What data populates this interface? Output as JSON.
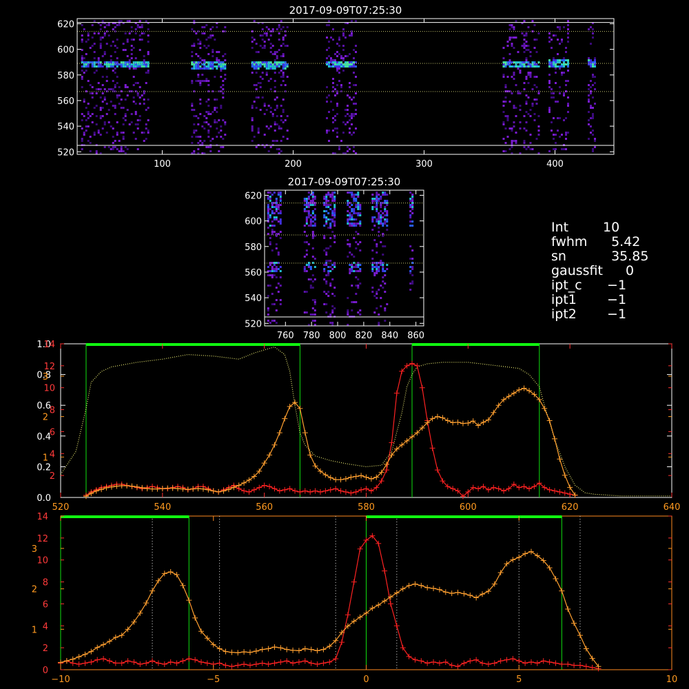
{
  "chart_data": [
    {
      "type": "heatmap",
      "id": "top-spectrogram",
      "title": "2017-09-09T07:25:30",
      "xlim": [
        35,
        445
      ],
      "ylim": [
        518,
        624
      ],
      "xticks": [
        100,
        200,
        300,
        400
      ],
      "yticks": [
        520,
        540,
        560,
        580,
        600,
        620
      ],
      "hlines_dotted": [
        614,
        589,
        567
      ],
      "hlines_solid": [
        621,
        525
      ],
      "bright_columns": [
        {
          "x": [
            38,
            90
          ],
          "core": 589
        },
        {
          "x": [
            122,
            148
          ],
          "core": 588
        },
        {
          "x": [
            168,
            196
          ],
          "core": 588
        },
        {
          "x": [
            225,
            248
          ],
          "core": 589
        },
        {
          "x": [
            360,
            388
          ],
          "core": 589
        },
        {
          "x": [
            395,
            410
          ],
          "core": 590
        },
        {
          "x": [
            425,
            430
          ],
          "core": 590
        }
      ]
    },
    {
      "type": "heatmap",
      "id": "zoom-spectrogram",
      "title": "2017-09-09T07:25:30",
      "xlim": [
        744,
        866
      ],
      "ylim": [
        518,
        624
      ],
      "xticks": [
        760,
        780,
        800,
        820,
        840,
        860
      ],
      "yticks": [
        520,
        540,
        560,
        580,
        600,
        620
      ],
      "hlines_dotted": [
        614,
        589,
        567
      ],
      "hlines_solid": [
        525
      ],
      "bright_columns": [
        {
          "x": [
            746,
            756
          ]
        },
        {
          "x": [
            774,
            782
          ]
        },
        {
          "x": [
            789,
            797
          ]
        },
        {
          "x": [
            807,
            817
          ]
        },
        {
          "x": [
            826,
            838
          ]
        },
        {
          "x": [
            855,
            858
          ]
        }
      ]
    },
    {
      "type": "line",
      "id": "profile-chart",
      "xlim": [
        520,
        640
      ],
      "xticks": [
        520,
        540,
        560,
        580,
        600,
        620,
        640
      ],
      "ylim_left_white": [
        0,
        1.0
      ],
      "yticks_left_white": [
        "0.0",
        "0.2",
        "0.4",
        "0.6",
        "0.8",
        "1.0"
      ],
      "ylim_left_red": [
        0,
        14
      ],
      "yticks_left_red": [
        "2",
        "4",
        "6",
        "8",
        "10",
        "12",
        "14"
      ],
      "yticks_left_orange": [
        "1",
        "2",
        "3"
      ],
      "orange_scale_max": 3.8,
      "green_bands": [
        [
          525,
          567
        ],
        [
          589,
          614
        ]
      ],
      "series": [
        {
          "color": "#e8e870",
          "style": "dotted",
          "axis": "white",
          "x": [
            520,
            523,
            525,
            526,
            528,
            530,
            535,
            540,
            545,
            550,
            555,
            558,
            560,
            562,
            564,
            565,
            566,
            567,
            568,
            570,
            573,
            576,
            580,
            583,
            585,
            587,
            588,
            589,
            590,
            592,
            595,
            600,
            605,
            610,
            612,
            614,
            615,
            617,
            619,
            621,
            623,
            625,
            630,
            635,
            640
          ],
          "y": [
            0.15,
            0.3,
            0.58,
            0.75,
            0.82,
            0.85,
            0.88,
            0.9,
            0.93,
            0.92,
            0.9,
            0.94,
            0.96,
            0.98,
            0.93,
            0.82,
            0.6,
            0.42,
            0.34,
            0.27,
            0.24,
            0.22,
            0.2,
            0.21,
            0.3,
            0.55,
            0.72,
            0.8,
            0.85,
            0.87,
            0.88,
            0.88,
            0.86,
            0.84,
            0.8,
            0.72,
            0.6,
            0.38,
            0.2,
            0.08,
            0.03,
            0.02,
            0.01,
            0.01,
            0.01
          ]
        },
        {
          "color": "#ff2222",
          "style": "line-plus",
          "axis": "red",
          "x": [
            525,
            526,
            527,
            528,
            529,
            530,
            531,
            532,
            533,
            534,
            535,
            536,
            537,
            538,
            539,
            540,
            541,
            542,
            543,
            544,
            545,
            546,
            547,
            548,
            549,
            550,
            551,
            552,
            553,
            554,
            555,
            556,
            557,
            558,
            559,
            560,
            561,
            562,
            563,
            564,
            565,
            566,
            567,
            568,
            569,
            570,
            571,
            572,
            573,
            574,
            575,
            576,
            577,
            578,
            579,
            580,
            581,
            582,
            583,
            584,
            585,
            586,
            587,
            588,
            589,
            590,
            591,
            592,
            593,
            594,
            595,
            596,
            597,
            598,
            599,
            600,
            601,
            602,
            603,
            604,
            605,
            606,
            607,
            608,
            609,
            610,
            611,
            612,
            613,
            614,
            615,
            616,
            617,
            618,
            619,
            620,
            621
          ],
          "y": [
            0.2,
            0.5,
            0.7,
            0.9,
            1.0,
            1.1,
            1.2,
            1.2,
            1.1,
            1.0,
            0.9,
            0.8,
            0.9,
            1.0,
            0.9,
            0.8,
            0.8,
            0.9,
            1.0,
            0.9,
            0.7,
            0.8,
            1.0,
            1.0,
            0.8,
            0.6,
            0.5,
            0.7,
            0.9,
            1.1,
            0.8,
            0.6,
            0.5,
            0.7,
            0.9,
            1.1,
            1.0,
            0.8,
            0.6,
            0.7,
            0.8,
            0.6,
            0.5,
            0.6,
            0.5,
            0.6,
            0.5,
            0.6,
            0.7,
            0.8,
            0.6,
            0.5,
            0.4,
            0.5,
            0.7,
            0.8,
            0.6,
            0.9,
            1.5,
            2.5,
            5.0,
            9.5,
            11.5,
            12.0,
            12.2,
            12.0,
            10.0,
            7.0,
            4.5,
            2.5,
            1.5,
            1.0,
            0.8,
            0.6,
            0.1,
            0.5,
            0.9,
            0.8,
            1.0,
            0.7,
            0.9,
            0.8,
            0.6,
            0.8,
            1.2,
            0.9,
            1.0,
            0.8,
            1.0,
            1.3,
            0.9,
            0.7,
            0.6,
            0.5,
            0.4,
            0.3,
            0.2
          ]
        },
        {
          "color": "#ffa030",
          "style": "line-plus",
          "axis": "orange",
          "x": [
            525,
            526,
            527,
            528,
            529,
            530,
            531,
            532,
            533,
            534,
            535,
            536,
            537,
            538,
            539,
            540,
            541,
            542,
            543,
            544,
            545,
            546,
            547,
            548,
            549,
            550,
            551,
            552,
            553,
            554,
            555,
            556,
            557,
            558,
            559,
            560,
            561,
            562,
            563,
            564,
            565,
            566,
            567,
            568,
            569,
            570,
            571,
            572,
            573,
            574,
            575,
            576,
            577,
            578,
            579,
            580,
            581,
            582,
            583,
            584,
            585,
            586,
            587,
            588,
            589,
            590,
            591,
            592,
            593,
            594,
            595,
            596,
            597,
            598,
            599,
            600,
            601,
            602,
            603,
            604,
            605,
            606,
            607,
            608,
            609,
            610,
            611,
            612,
            613,
            614,
            615,
            616,
            617,
            618,
            619,
            620,
            621
          ],
          "y": [
            0.03,
            0.1,
            0.16,
            0.2,
            0.24,
            0.26,
            0.28,
            0.29,
            0.29,
            0.28,
            0.26,
            0.24,
            0.22,
            0.21,
            0.21,
            0.22,
            0.23,
            0.23,
            0.22,
            0.21,
            0.2,
            0.21,
            0.22,
            0.21,
            0.19,
            0.16,
            0.14,
            0.16,
            0.2,
            0.25,
            0.3,
            0.36,
            0.43,
            0.52,
            0.65,
            0.85,
            1.05,
            1.3,
            1.6,
            1.95,
            2.25,
            2.35,
            2.2,
            1.6,
            1.05,
            0.78,
            0.65,
            0.56,
            0.49,
            0.44,
            0.44,
            0.46,
            0.5,
            0.52,
            0.54,
            0.5,
            0.46,
            0.5,
            0.62,
            0.82,
            1.05,
            1.2,
            1.3,
            1.4,
            1.5,
            1.6,
            1.72,
            1.85,
            1.95,
            2.0,
            1.97,
            1.9,
            1.85,
            1.86,
            1.83,
            1.84,
            1.89,
            1.78,
            1.86,
            1.92,
            2.1,
            2.28,
            2.42,
            2.5,
            2.58,
            2.66,
            2.7,
            2.64,
            2.55,
            2.42,
            2.2,
            1.9,
            1.45,
            0.95,
            0.55,
            0.25,
            0.06
          ]
        }
      ]
    },
    {
      "type": "line",
      "id": "velocity-chart",
      "xlim": [
        -10,
        10
      ],
      "xticks": [
        -10,
        -5,
        0,
        5,
        10
      ],
      "ylim_left_red": [
        0,
        14
      ],
      "yticks_left_red": [
        "0",
        "2",
        "4",
        "6",
        "8",
        "10",
        "12",
        "14"
      ],
      "yticks_left_orange": [
        "1",
        "2",
        "3"
      ],
      "orange_scale_max": 3.8,
      "green_bands": [
        [
          -10,
          -5.8
        ],
        [
          0,
          6.4
        ]
      ],
      "vlines_dotted": [
        -7,
        -4.8,
        -1,
        1,
        5,
        7
      ],
      "series": [
        {
          "color": "#ff2222",
          "style": "line-plus",
          "axis": "red",
          "x": [
            -10,
            -9.8,
            -9.6,
            -9.4,
            -9.2,
            -9,
            -8.8,
            -8.6,
            -8.4,
            -8.2,
            -8,
            -7.8,
            -7.6,
            -7.4,
            -7.2,
            -7,
            -6.8,
            -6.6,
            -6.4,
            -6.2,
            -6,
            -5.8,
            -5.6,
            -5.4,
            -5.2,
            -5,
            -4.8,
            -4.6,
            -4.4,
            -4.2,
            -4,
            -3.8,
            -3.6,
            -3.4,
            -3.2,
            -3,
            -2.8,
            -2.6,
            -2.4,
            -2.2,
            -2,
            -1.8,
            -1.6,
            -1.4,
            -1.2,
            -1,
            -0.8,
            -0.6,
            -0.4,
            -0.2,
            0,
            0.2,
            0.4,
            0.6,
            0.8,
            1,
            1.2,
            1.4,
            1.6,
            1.8,
            2,
            2.2,
            2.4,
            2.6,
            2.8,
            3,
            3.2,
            3.4,
            3.6,
            3.8,
            4,
            4.2,
            4.4,
            4.6,
            4.8,
            5,
            5.2,
            5.4,
            5.6,
            5.8,
            6,
            6.2,
            6.4,
            6.6,
            6.8,
            7,
            7.2,
            7.4,
            7.6
          ],
          "y": [
            0.6,
            0.8,
            0.6,
            0.5,
            0.6,
            0.7,
            0.9,
            1.0,
            0.8,
            0.6,
            0.6,
            0.8,
            0.7,
            0.5,
            0.6,
            0.8,
            0.6,
            0.5,
            0.7,
            0.6,
            0.8,
            1.0,
            0.9,
            0.7,
            0.6,
            0.5,
            0.6,
            0.4,
            0.3,
            0.4,
            0.5,
            0.4,
            0.5,
            0.6,
            0.5,
            0.6,
            0.7,
            0.8,
            0.6,
            0.7,
            0.8,
            0.6,
            0.5,
            0.6,
            0.7,
            1.0,
            2.5,
            5.0,
            8.0,
            11.0,
            11.8,
            12.2,
            11.5,
            9.0,
            6.0,
            4.0,
            2.0,
            1.2,
            0.9,
            0.8,
            0.6,
            0.7,
            0.6,
            0.7,
            0.4,
            0.3,
            0.6,
            0.8,
            0.9,
            0.6,
            0.5,
            0.6,
            0.8,
            0.9,
            1.0,
            0.8,
            0.6,
            0.7,
            0.6,
            0.8,
            0.7,
            0.6,
            0.5,
            0.5,
            0.4,
            0.4,
            0.3,
            0.2,
            0.1
          ]
        },
        {
          "color": "#ffa030",
          "style": "line-plus",
          "axis": "orange",
          "x": [
            -10,
            -9.8,
            -9.6,
            -9.4,
            -9.2,
            -9,
            -8.8,
            -8.6,
            -8.4,
            -8.2,
            -8,
            -7.8,
            -7.6,
            -7.4,
            -7.2,
            -7,
            -6.8,
            -6.6,
            -6.4,
            -6.2,
            -6,
            -5.8,
            -5.6,
            -5.4,
            -5.2,
            -5,
            -4.8,
            -4.6,
            -4.4,
            -4.2,
            -4,
            -3.8,
            -3.6,
            -3.4,
            -3.2,
            -3,
            -2.8,
            -2.6,
            -2.4,
            -2.2,
            -2,
            -1.8,
            -1.6,
            -1.4,
            -1.2,
            -1,
            -0.8,
            -0.6,
            -0.4,
            -0.2,
            0,
            0.2,
            0.4,
            0.6,
            0.8,
            1,
            1.2,
            1.4,
            1.6,
            1.8,
            2,
            2.2,
            2.4,
            2.6,
            2.8,
            3,
            3.2,
            3.4,
            3.6,
            3.8,
            4,
            4.2,
            4.4,
            4.6,
            4.8,
            5,
            5.2,
            5.4,
            5.6,
            5.8,
            6,
            6.2,
            6.4,
            6.6,
            6.8,
            7,
            7.2,
            7.4,
            7.6
          ],
          "y": [
            0.18,
            0.22,
            0.26,
            0.32,
            0.38,
            0.45,
            0.55,
            0.62,
            0.7,
            0.8,
            0.85,
            1.0,
            1.18,
            1.4,
            1.65,
            1.95,
            2.2,
            2.38,
            2.42,
            2.35,
            2.08,
            1.72,
            1.28,
            0.95,
            0.78,
            0.62,
            0.52,
            0.45,
            0.43,
            0.42,
            0.44,
            0.43,
            0.46,
            0.5,
            0.52,
            0.56,
            0.54,
            0.5,
            0.48,
            0.47,
            0.52,
            0.5,
            0.47,
            0.5,
            0.58,
            0.72,
            0.92,
            1.08,
            1.2,
            1.3,
            1.4,
            1.52,
            1.6,
            1.7,
            1.8,
            1.9,
            2.0,
            2.08,
            2.12,
            2.08,
            2.03,
            2.01,
            1.98,
            1.92,
            1.89,
            1.91,
            1.88,
            1.84,
            1.78,
            1.87,
            1.94,
            2.12,
            2.4,
            2.62,
            2.72,
            2.78,
            2.87,
            2.92,
            2.82,
            2.7,
            2.52,
            2.25,
            1.95,
            1.5,
            1.15,
            0.85,
            0.52,
            0.28,
            0.08
          ]
        }
      ]
    }
  ],
  "info": {
    "rows": [
      {
        "k": "Int",
        "v": "10"
      },
      {
        "k": "fwhm",
        "v": "  5.42"
      },
      {
        "k": "sn",
        "v": "  35.85"
      },
      {
        "k": "gaussfit",
        "v": "0"
      },
      {
        "k": "ipt_c",
        "v": " −1"
      },
      {
        "k": "ipt1",
        "v": " −1"
      },
      {
        "k": "ipt2",
        "v": " −1"
      }
    ]
  }
}
